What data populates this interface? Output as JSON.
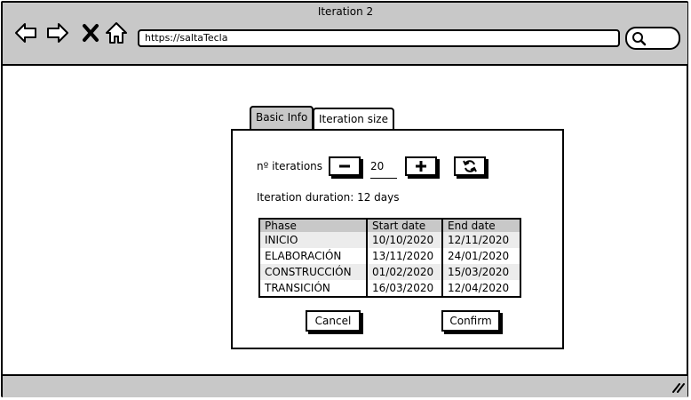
{
  "window": {
    "title": "Iteration 2"
  },
  "browser": {
    "url": "https://saltaTecla"
  },
  "tabs": [
    {
      "label": "Basic Info",
      "active": false
    },
    {
      "label": "Iteration size",
      "active": true
    }
  ],
  "iterations": {
    "label": "nº iterations",
    "value": "20"
  },
  "duration": {
    "text": "Iteration duration: 12 days"
  },
  "table": {
    "headers": [
      "Phase",
      "Start date",
      "End date"
    ],
    "rows": [
      [
        "INICIO",
        "10/10/2020",
        "12/11/2020"
      ],
      [
        "ELABORACIÓN",
        "13/11/2020",
        "24/01/2020"
      ],
      [
        "CONSTRUCCIÓN",
        "01/02/2020",
        "15/03/2020"
      ],
      [
        "TRANSICIÓN",
        "16/03/2020",
        "12/04/2020"
      ]
    ]
  },
  "actions": {
    "cancel": "Cancel",
    "confirm": "Confirm"
  },
  "icons": {
    "back": "arrow-left-icon",
    "forward": "arrow-right-icon",
    "stop": "close-icon",
    "home": "home-icon",
    "search": "search-icon",
    "decrement": "minus-icon",
    "increment": "plus-icon",
    "reset": "refresh-icon",
    "resize": "resize-grip-icon"
  },
  "colors": {
    "chrome": "#c8c8c8",
    "row_alt": "#ececec"
  }
}
